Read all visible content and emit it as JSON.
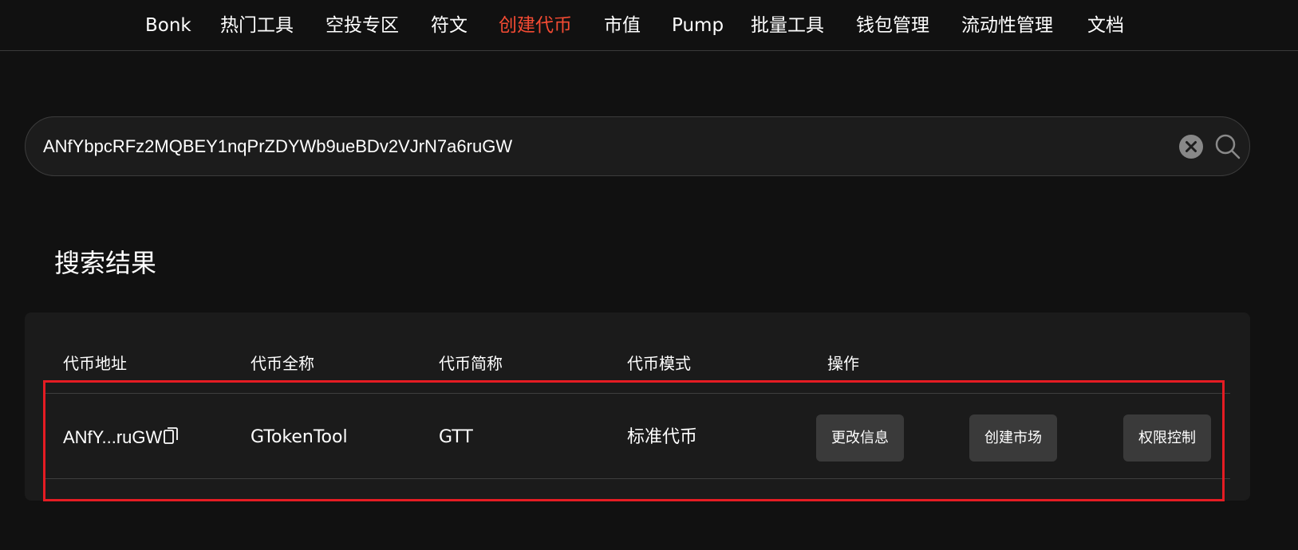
{
  "nav": {
    "items": [
      {
        "label": "Bonk",
        "active": false
      },
      {
        "label": "热门工具",
        "active": false
      },
      {
        "label": "空投专区",
        "active": false
      },
      {
        "label": "符文",
        "active": false
      },
      {
        "label": "创建代币",
        "active": true
      },
      {
        "label": "市值",
        "active": false
      },
      {
        "label": "Pump",
        "active": false
      },
      {
        "label": "批量工具",
        "active": false
      },
      {
        "label": "钱包管理",
        "active": false
      },
      {
        "label": "流动性管理",
        "active": false
      },
      {
        "label": "文档",
        "active": false
      }
    ]
  },
  "search": {
    "value": "ANfYbpcRFz2MQBEY1nqPrZDYWb9ueBDv2VJrN7a6ruGW",
    "clear_icon": "close-circle-icon",
    "search_icon": "magnifier-icon"
  },
  "results": {
    "title": "搜索结果",
    "headers": {
      "address": "代币地址",
      "full_name": "代币全称",
      "short_name": "代币简称",
      "mode": "代币模式",
      "actions": "操作"
    },
    "rows": [
      {
        "address": "ANfY...ruGW",
        "copy_icon": "copy-icon",
        "full_name": "GTokenTool",
        "short_name": "GTT",
        "mode": "标准代币",
        "buttons": {
          "edit": "更改信息",
          "market": "创建市场",
          "authority": "权限控制"
        }
      }
    ]
  },
  "colors": {
    "background": "#111111",
    "panel": "#1b1b1b",
    "active_nav": "#f44b33",
    "button": "#3a3a3a",
    "highlight": "#e51c23"
  }
}
